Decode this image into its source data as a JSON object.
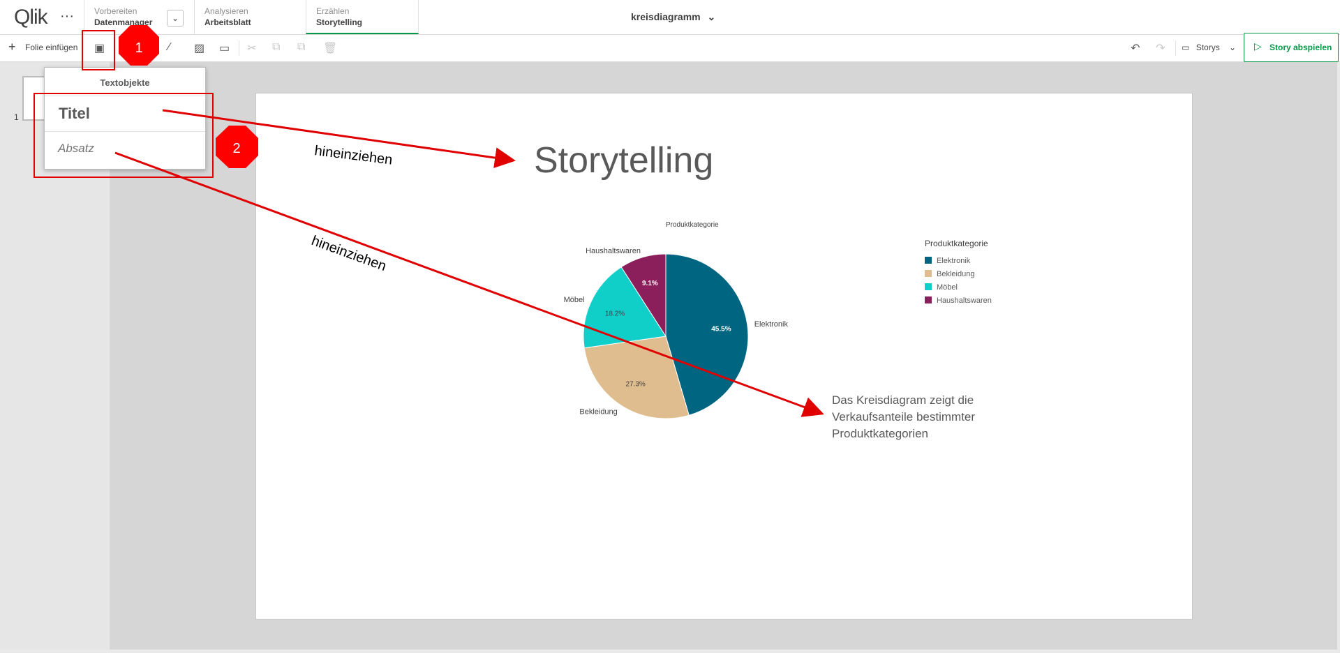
{
  "topbar": {
    "logo": "Qlik",
    "menu_icon": "more-dots-icon",
    "tabs": [
      {
        "small": "Vorbereiten",
        "big": "Datenmanager"
      },
      {
        "small": "Analysieren",
        "big": "Arbeitsblatt"
      },
      {
        "small": "Erzählen",
        "big": "Storytelling"
      }
    ],
    "app_title": "kreisdiagramm"
  },
  "toolbar": {
    "insert_slide": "Folie einfügen",
    "storys": "Storys",
    "play": "Story abspielen"
  },
  "sidebar": {
    "slide_number": "1"
  },
  "popup": {
    "header": "Textobjekte",
    "title_item": "Titel",
    "paragraph_item": "Absatz"
  },
  "slide": {
    "title": "Storytelling",
    "paragraph": "Das Kreisdiagram zeigt die Verkaufsanteile bestimmter Produktkategorien"
  },
  "annotations": {
    "badge1": "1",
    "badge2": "2",
    "arrow_text1": "hineinziehen",
    "arrow_text2": "hineinziehen",
    "color": "#e00000"
  },
  "chart_data": {
    "type": "pie",
    "title": "Produktkategorie",
    "legend_title": "Produktkategorie",
    "legend_position": "right",
    "categories": [
      "Elektronik",
      "Bekleidung",
      "Möbel",
      "Haushaltswaren"
    ],
    "values": [
      45.5,
      27.3,
      18.2,
      9.1
    ],
    "labels": [
      "45.5%",
      "27.3%",
      "18.2%",
      "9.1%"
    ],
    "colors": [
      "#006580",
      "#e0bd8f",
      "#10cfc9",
      "#8a1f5b"
    ]
  }
}
